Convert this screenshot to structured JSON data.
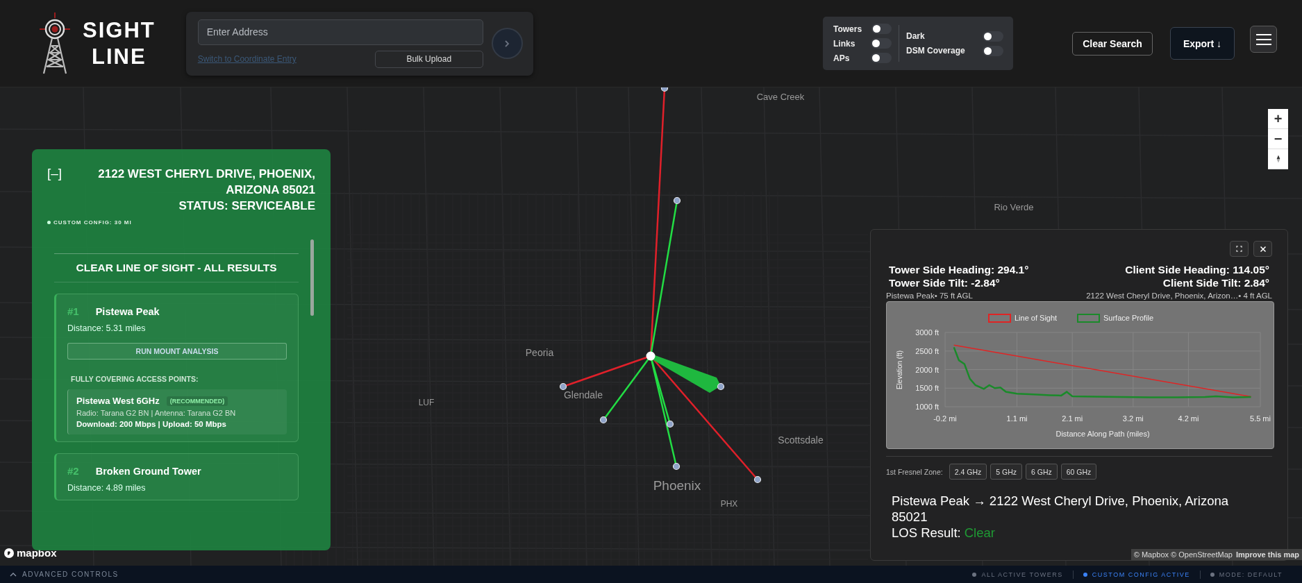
{
  "logo": {
    "lines": [
      "SIGHT",
      "LINE"
    ]
  },
  "search": {
    "placeholder": "Enter Address",
    "switch_link": "Switch to Coordinate Entry",
    "bulk_upload": "Bulk Upload"
  },
  "layers": [
    {
      "label": "Towers",
      "on": false
    },
    {
      "label": "Links",
      "on": false
    },
    {
      "label": "APs",
      "on": false
    }
  ],
  "options": [
    {
      "label": "Dark",
      "on": false
    },
    {
      "label": "DSM Coverage",
      "on": false
    }
  ],
  "actions": {
    "clear_search": "Clear Search",
    "export": "Export ↓"
  },
  "map": {
    "labels": [
      "Cave Creek",
      "Rio Verde",
      "Peoria",
      "Glendale",
      "LUF",
      "Scottsdale",
      "Phoenix",
      "PHX"
    ],
    "zoom_in": "+",
    "zoom_out": "−",
    "logo": "mapbox",
    "attribution": "© Mapbox © OpenStreetMap",
    "improve_link": "Improve this map"
  },
  "results_panel": {
    "collapse": "[–]",
    "address": "2122 WEST CHERYL DRIVE, PHOENIX, ARIZONA 85021",
    "status": "STATUS: SERVICEABLE",
    "config": "CUSTOM CONFIG: 30 MI",
    "section_title": "CLEAR LINE OF SIGHT - ALL RESULTS",
    "results": [
      {
        "rank": "#1",
        "name": "Pistewa Peak",
        "distance": "Distance: 5.31 miles",
        "action": "RUN MOUNT ANALYSIS",
        "ap_heading": "FULLY COVERING ACCESS POINTS:",
        "access_points": [
          {
            "name": "Pistewa West 6GHz",
            "badge": "(RECOMMENDED)",
            "radio": "Radio: Tarana G2 BN | Antenna: Tarana G2 BN",
            "speeds": "Download: 200 Mbps | Upload: 50 Mbps"
          }
        ]
      },
      {
        "rank": "#2",
        "name": "Broken Ground Tower",
        "distance": "Distance: 4.89 miles"
      }
    ]
  },
  "profile_panel": {
    "tower_heading": "Tower Side Heading: 294.1°",
    "tower_tilt": "Tower Side Tilt: -2.84°",
    "client_heading": "Client Side Heading: 114.05°",
    "client_tilt": "Client Side Tilt: 2.84°",
    "tower_label": "Pistewa Peak• 75 ft AGL",
    "client_label": "2122 West Cheryl Drive, Phoenix, Arizon…• 4 ft AGL",
    "chart_data": {
      "type": "line",
      "xlabel": "Distance Along Path (miles)",
      "ylabel": "Elevation (ft)",
      "x": [
        -0.04,
        0.05,
        0.15,
        0.25,
        0.35,
        0.5,
        0.6,
        0.7,
        0.8,
        0.9,
        1.1,
        1.4,
        1.7,
        1.9,
        2.0,
        2.1,
        2.5,
        3.0,
        3.5,
        4.0,
        4.5,
        4.7,
        5.0,
        5.33
      ],
      "series": [
        {
          "name": "Line of Sight",
          "color": "#e02424",
          "values": [
            2660,
            null,
            null,
            null,
            null,
            null,
            null,
            null,
            null,
            null,
            null,
            null,
            null,
            null,
            null,
            null,
            null,
            null,
            null,
            null,
            null,
            null,
            null,
            1270
          ]
        },
        {
          "name": "Surface Profile",
          "color": "#1a8a2a",
          "values": [
            2600,
            2250,
            2150,
            1750,
            1580,
            1480,
            1580,
            1500,
            1520,
            1400,
            1350,
            1330,
            1310,
            1300,
            1400,
            1280,
            1270,
            1260,
            1250,
            1250,
            1260,
            1280,
            1250,
            1260
          ]
        }
      ],
      "xlim": [
        -0.2,
        5.5
      ],
      "ylim": [
        1000,
        3000
      ],
      "grid": true,
      "legend": true,
      "xticks": [
        {
          "value": -0.2,
          "label": "-0.2 mi"
        },
        {
          "value": 1.1,
          "label": "1.1 mi"
        },
        {
          "value": 2.1,
          "label": "2.1 mi"
        },
        {
          "value": 3.2,
          "label": "3.2 mi"
        },
        {
          "value": 4.2,
          "label": "4.2 mi"
        },
        {
          "value": 5.5,
          "label": "5.5 mi"
        }
      ],
      "yticks": [
        {
          "value": 1000,
          "label": "1000 ft"
        },
        {
          "value": 1500,
          "label": "1500 ft"
        },
        {
          "value": 2000,
          "label": "2000 ft"
        },
        {
          "value": 2500,
          "label": "2500 ft"
        },
        {
          "value": 3000,
          "label": "3000 ft"
        }
      ]
    },
    "fresnel_label": "1st Fresnel Zone:",
    "fresnel_options": [
      "2.4 GHz",
      "5 GHz",
      "6 GHz",
      "60 GHz"
    ],
    "path": "Pistewa Peak → 2122 West Cheryl Drive, Phoenix, Arizona 85021",
    "los_label": "LOS Result:",
    "los_value": "Clear",
    "los_clear": true
  },
  "status_bar": {
    "advanced": "ADVANCED CONTROLS",
    "items": [
      {
        "label": "ALL ACTIVE TOWERS",
        "color": "#6b7280"
      },
      {
        "label": "CUSTOM CONFIG ACTIVE",
        "color": "#3b82f6"
      },
      {
        "label": "MODE: DEFAULT",
        "color": "#6b7280"
      }
    ]
  }
}
